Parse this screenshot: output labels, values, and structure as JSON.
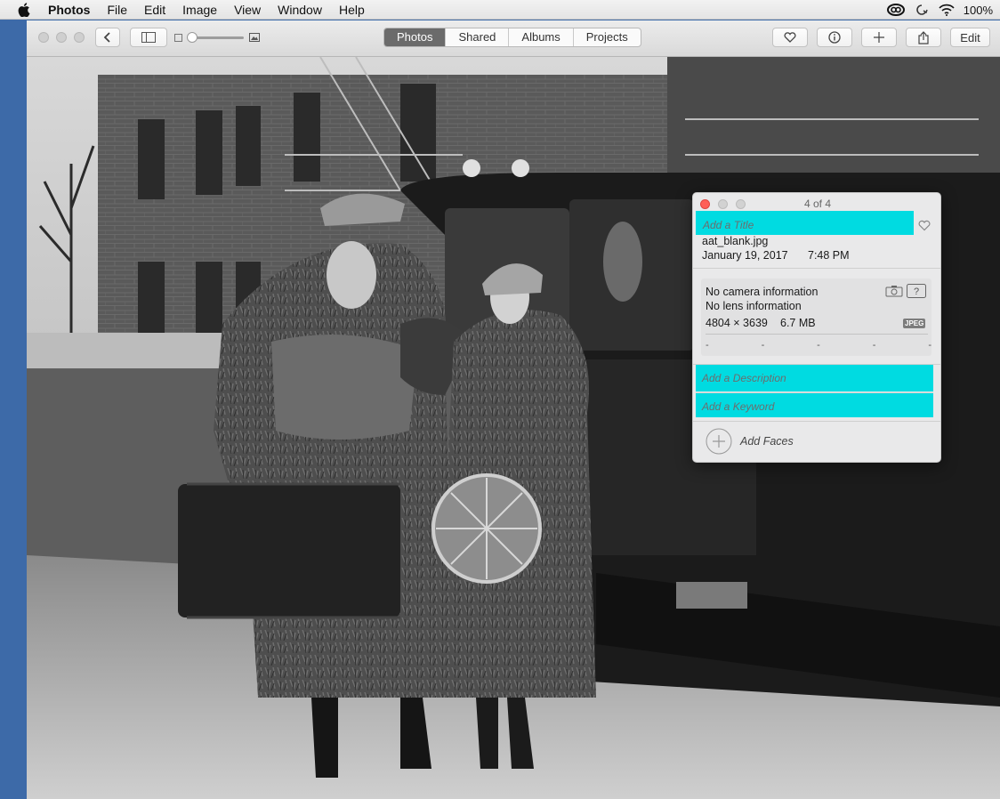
{
  "menubar": {
    "app": "Photos",
    "items": [
      "File",
      "Edit",
      "Image",
      "View",
      "Window",
      "Help"
    ],
    "battery": "100%"
  },
  "toolbar": {
    "tabs": [
      {
        "label": "Photos",
        "active": true
      },
      {
        "label": "Shared",
        "active": false
      },
      {
        "label": "Albums",
        "active": false
      },
      {
        "label": "Projects",
        "active": false
      }
    ],
    "edit_label": "Edit",
    "zoom_slider_value": 0.0
  },
  "info_panel": {
    "counter": "4 of 4",
    "title_placeholder": "Add a Title",
    "filename": "aat_blank.jpg",
    "date": "January 19, 2017",
    "time": "7:48 PM",
    "camera": "No camera information",
    "lens": "No lens information",
    "dimensions": "4804 × 3639",
    "filesize": "6.7 MB",
    "format_badge": "JPEG",
    "exif_values": [
      "-",
      "-",
      "-",
      "-",
      "-"
    ],
    "description_placeholder": "Add a Description",
    "keyword_placeholder": "Add a Keyword",
    "faces_label": "Add Faces",
    "highlight_color": "#00dbe1"
  }
}
